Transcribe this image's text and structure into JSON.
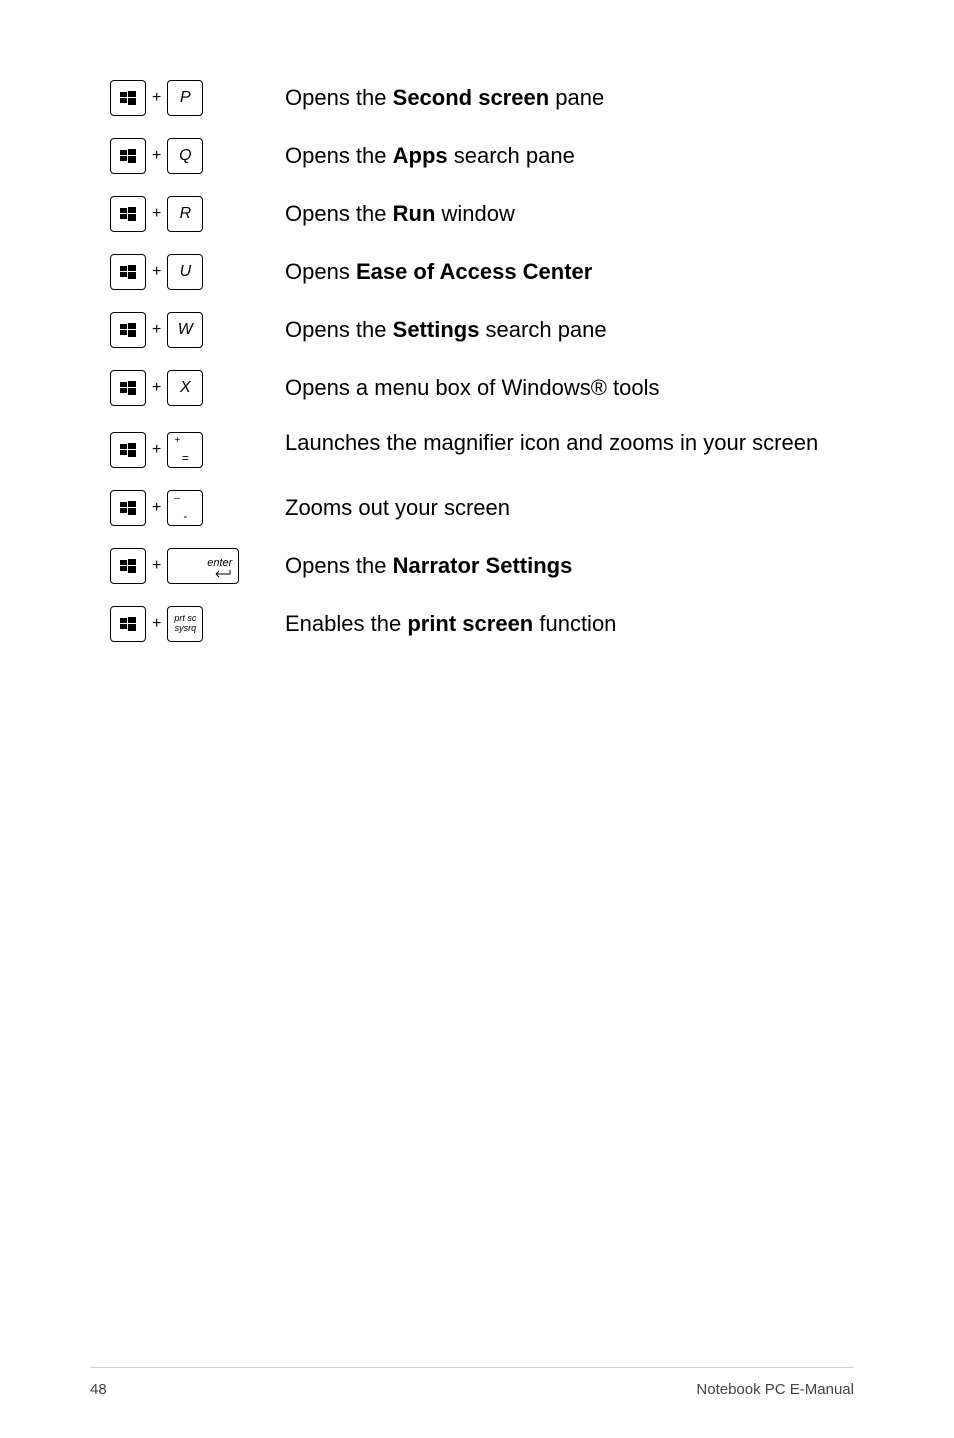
{
  "shortcuts": [
    {
      "key2": "P",
      "key2_type": "letter",
      "desc_pre": "Opens the ",
      "desc_bold": "Second screen",
      "desc_post": " pane"
    },
    {
      "key2": "Q",
      "key2_type": "letter",
      "desc_pre": "Opens the ",
      "desc_bold": "Apps",
      "desc_post": " search pane"
    },
    {
      "key2": "R",
      "key2_type": "letter",
      "desc_pre": "Opens the ",
      "desc_bold": "Run",
      "desc_post": " window"
    },
    {
      "key2": "U",
      "key2_type": "letter",
      "desc_pre": "Opens ",
      "desc_bold": "Ease of Access Center",
      "desc_post": ""
    },
    {
      "key2": "W",
      "key2_type": "letter",
      "desc_pre": "Opens the ",
      "desc_bold": "Settings",
      "desc_post": " search pane"
    },
    {
      "key2": "X",
      "key2_type": "letter",
      "desc_pre": "Opens a menu box of Windows® tools",
      "desc_bold": "",
      "desc_post": ""
    },
    {
      "key2_top": "+",
      "key2_bottom": "=",
      "key2_type": "symbol",
      "desc_pre": "Launches the magnifier icon and zooms in your screen",
      "desc_bold": "",
      "desc_post": ""
    },
    {
      "key2_top": "–",
      "key2_bottom": "-",
      "key2_type": "symbol",
      "desc_pre": "Zooms out your screen",
      "desc_bold": "",
      "desc_post": ""
    },
    {
      "key2": "enter",
      "key2_type": "enter",
      "desc_pre": "Opens the ",
      "desc_bold": "Narrator Settings",
      "desc_post": ""
    },
    {
      "key2_line1": "prt sc",
      "key2_line2": "sysrq",
      "key2_type": "prtsc",
      "desc_pre": "Enables the ",
      "desc_bold": "print screen",
      "desc_post": " function"
    }
  ],
  "footer": {
    "page_number": "48",
    "title": "Notebook PC E-Manual"
  },
  "labels": {
    "plus": "+"
  }
}
